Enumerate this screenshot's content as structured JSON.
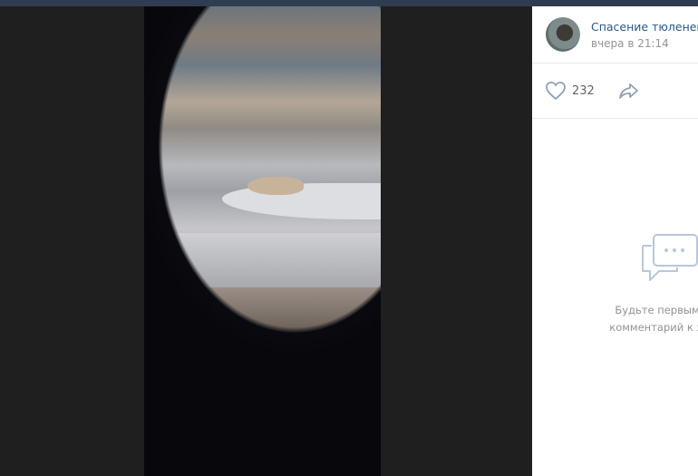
{
  "post": {
    "author": "Спасение тюленей",
    "date": "вчера в 21:14"
  },
  "actions": {
    "like_count": "232",
    "like_icon": "heart-icon",
    "share_icon": "share-arrow-icon"
  },
  "comments": {
    "empty_icon": "comments-bubble-icon",
    "empty_line1": "Будьте первым, кто",
    "empty_line2": "комментарий к этой з"
  },
  "colors": {
    "link": "#2a5885",
    "muted": "#939393",
    "viewer_bg": "#1d1d1d"
  }
}
